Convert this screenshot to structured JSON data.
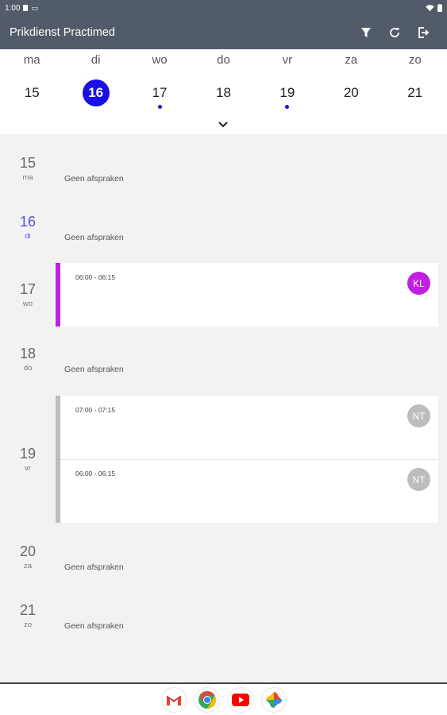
{
  "status_bar": {
    "time": "1:00"
  },
  "app_bar": {
    "title": "Prikdienst Practimed",
    "actions": [
      "filter-icon",
      "refresh-icon",
      "logout-icon"
    ]
  },
  "colors": {
    "app_bar": "#525b6a",
    "accent": "#1a0fe6",
    "today_text": "#5a4fe0",
    "event_kl": "#c020e0",
    "event_nt": "#bdbdbd"
  },
  "week": [
    {
      "abbr": "ma",
      "num": "15",
      "selected": false,
      "has_events": false
    },
    {
      "abbr": "di",
      "num": "16",
      "selected": true,
      "has_events": false
    },
    {
      "abbr": "wo",
      "num": "17",
      "selected": false,
      "has_events": true
    },
    {
      "abbr": "do",
      "num": "18",
      "selected": false,
      "has_events": false
    },
    {
      "abbr": "vr",
      "num": "19",
      "selected": false,
      "has_events": true
    },
    {
      "abbr": "za",
      "num": "20",
      "selected": false,
      "has_events": false
    },
    {
      "abbr": "zo",
      "num": "21",
      "selected": false,
      "has_events": false
    }
  ],
  "agenda": {
    "no_appointments_label": "Geen afspraken",
    "days": [
      {
        "num": "15",
        "abbr": "ma",
        "events": []
      },
      {
        "num": "16",
        "abbr": "di",
        "today": true,
        "events": []
      },
      {
        "num": "17",
        "abbr": "wo",
        "events": [
          {
            "time": "06:00 - 06:15",
            "initials": "KL"
          }
        ]
      },
      {
        "num": "18",
        "abbr": "do",
        "events": []
      },
      {
        "num": "19",
        "abbr": "vr",
        "events": [
          {
            "time": "07:00 - 07:15",
            "initials": "NT"
          },
          {
            "time": "06:00 - 06:15",
            "initials": "NT"
          }
        ]
      },
      {
        "num": "20",
        "abbr": "za",
        "events": []
      },
      {
        "num": "21",
        "abbr": "zo",
        "events": []
      }
    ]
  },
  "nav_bar": {
    "apps": [
      "gmail-icon",
      "chrome-icon",
      "youtube-icon",
      "photos-icon"
    ]
  }
}
